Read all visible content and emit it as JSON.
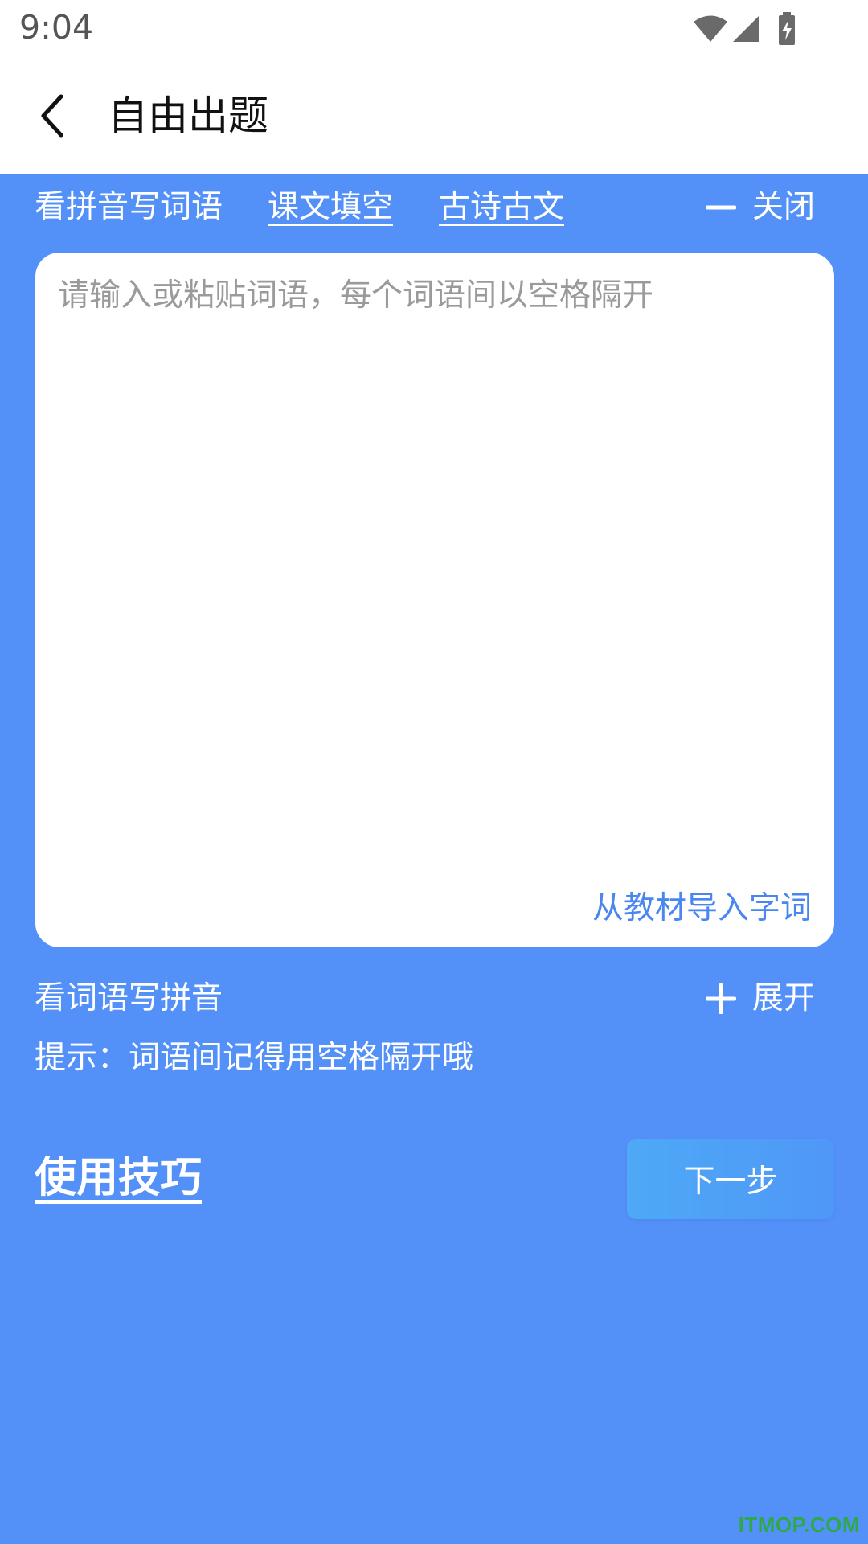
{
  "status_bar": {
    "time": "9:04",
    "icons": [
      "wifi-icon",
      "signal-icon",
      "battery-charging-icon"
    ]
  },
  "app_bar": {
    "title": "自由出题",
    "back_icon": "chevron-left-icon"
  },
  "section_pinyin_to_words": {
    "title": "看拼音写词语",
    "link_text_fill": "课文填空",
    "link_ancient_poems": "古诗古文",
    "toggle_label": "关闭",
    "toggle_icon": "minus-icon",
    "input_placeholder": "请输入或粘贴词语，每个词语间以空格隔开",
    "input_value": "",
    "import_link": "从教材导入字词"
  },
  "section_words_to_pinyin": {
    "title": "看词语写拼音",
    "toggle_label": "展开",
    "toggle_icon": "plus-icon"
  },
  "hint": "提示：词语间记得用空格隔开哦",
  "tips_link": "使用技巧",
  "next_button": "下一步",
  "watermark": "ITMOP.COM",
  "colors": {
    "background": "#5391f8",
    "card": "#ffffff",
    "link_blue": "#4a86f0",
    "next_button": "#4ea9f6",
    "watermark": "#2fa84a"
  }
}
